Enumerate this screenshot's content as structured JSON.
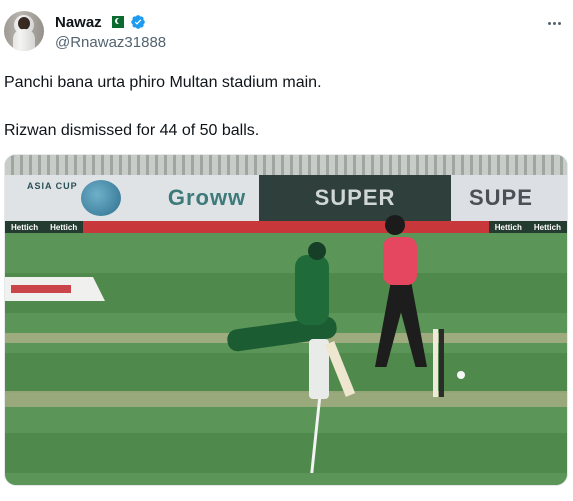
{
  "post": {
    "author": {
      "display_name": "Nawaz",
      "handle": "@Rnawaz31888",
      "flag_icon": "pakistan-flag-icon",
      "verified_icon": "verified-badge-icon",
      "verified_color": "#1d9bf0"
    },
    "more_icon": "more-options-icon",
    "text_lines": [
      "Panchi bana urta phiro Multan stadium main.",
      "Rizwan dismissed for 44 of 50 balls."
    ]
  },
  "media": {
    "hoardings": {
      "left": "Groww",
      "left_small": "ASIA CUP",
      "center": "SUPER",
      "right": "SUPE"
    },
    "adboard_segments": [
      "Hettich",
      "Hettich",
      "Hettich",
      "Hettich"
    ]
  },
  "colors": {
    "text_primary": "#0f1419",
    "text_secondary": "#536471",
    "pitch_green": "#4f8a4c"
  }
}
